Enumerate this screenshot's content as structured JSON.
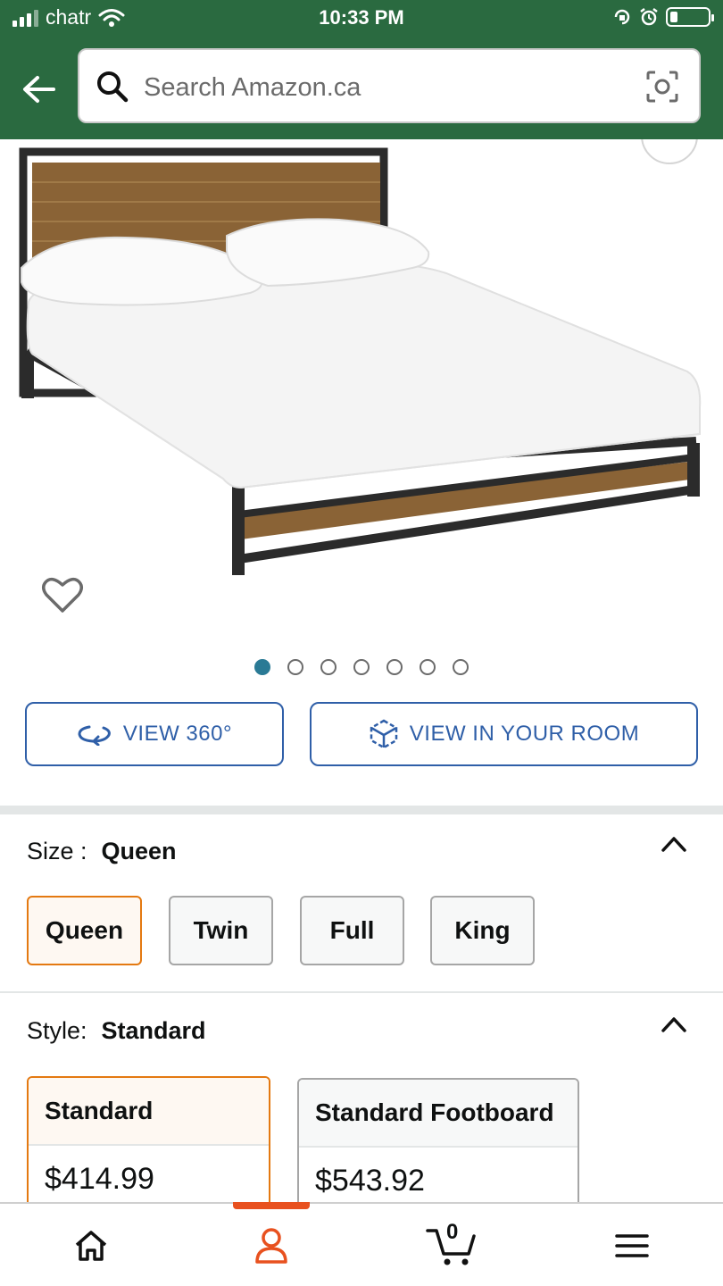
{
  "status_bar": {
    "carrier": "chatr",
    "time": "10:33 PM",
    "icons": [
      "signal-icon",
      "wifi-icon",
      "orientation-lock-icon",
      "alarm-icon",
      "battery-icon"
    ]
  },
  "header": {
    "back_icon": "back-arrow-icon",
    "search_placeholder": "Search Amazon.ca",
    "search_icon": "search-icon",
    "camera_icon": "camera-scan-icon"
  },
  "gallery": {
    "image_alt": "platform bed with wooden headboard and white mattress",
    "total_images": 7,
    "active_index": 0
  },
  "view_buttons": {
    "view_360": "VIEW 360°",
    "view_room": "VIEW IN YOUR ROOM"
  },
  "size": {
    "label": "Size :",
    "selected": "Queen",
    "options": [
      "Queen",
      "Twin",
      "Full",
      "King"
    ]
  },
  "style": {
    "label": "Style:",
    "selected": "Standard",
    "options": [
      {
        "name": "Standard",
        "price": "$414.99"
      },
      {
        "name": "Standard Footboard",
        "price": "$543.92"
      }
    ]
  },
  "bottom_nav": {
    "items": [
      "home-icon",
      "account-icon",
      "cart-icon",
      "menu-icon"
    ],
    "active": "account-icon",
    "cart_count": "0"
  },
  "colors": {
    "header_green": "#2a6a40",
    "link_blue": "#2f5fa8",
    "selected_orange": "#e47911",
    "active_nav_orange": "#e8511f",
    "dot_active": "#2a7a95"
  }
}
